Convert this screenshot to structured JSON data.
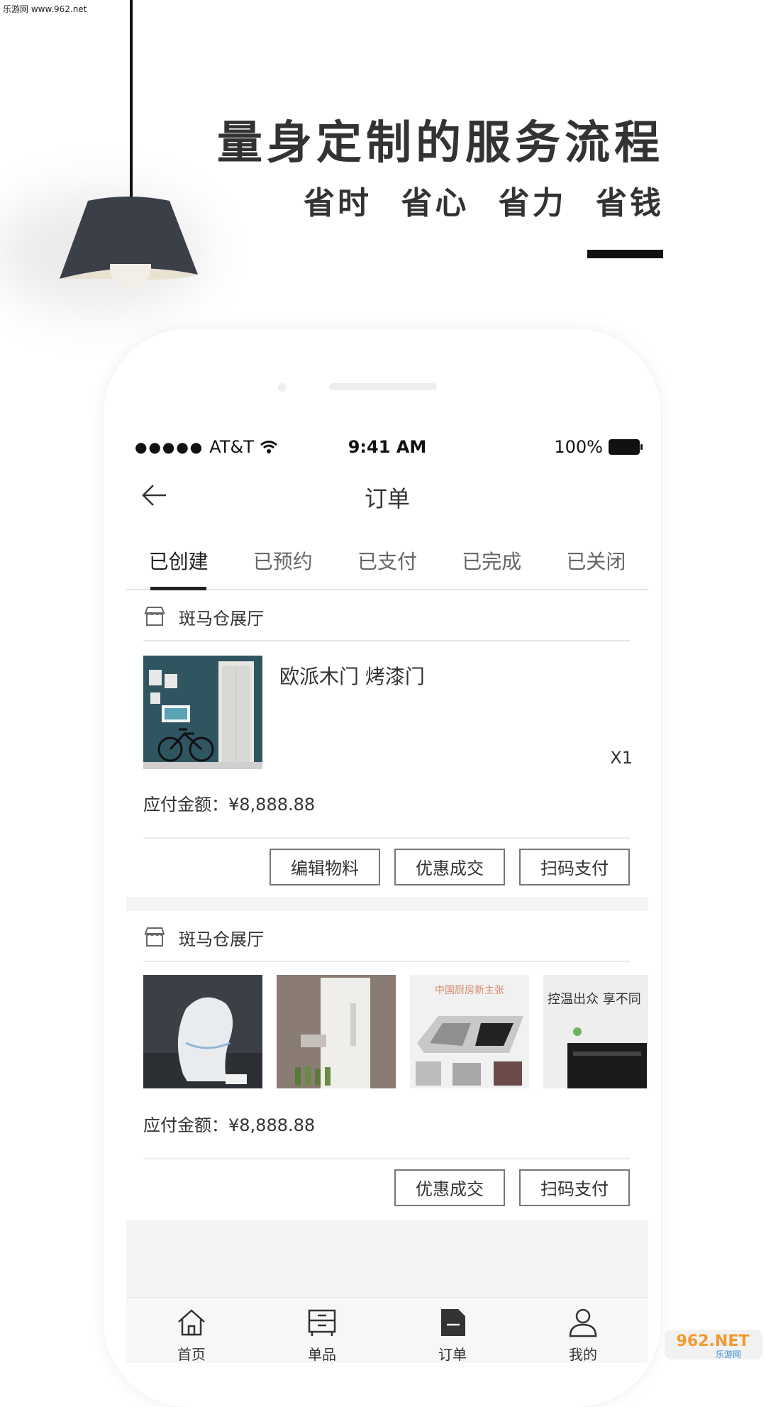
{
  "watermark": "乐游网 www.962.net",
  "hero": {
    "headline": "量身定制的服务流程",
    "taglines": [
      "省时",
      "省心",
      "省力",
      "省钱"
    ]
  },
  "status_bar": {
    "carrier": "AT&T",
    "time": "9:41 AM",
    "battery": "100%"
  },
  "nav": {
    "title": "订单"
  },
  "tabs": [
    {
      "label": "已创建",
      "active": true
    },
    {
      "label": "已预约",
      "active": false
    },
    {
      "label": "已支付",
      "active": false
    },
    {
      "label": "已完成",
      "active": false
    },
    {
      "label": "已关闭",
      "active": false
    }
  ],
  "orders": [
    {
      "shop": "斑马仓展厅",
      "product_title": "欧派木门 烤漆门",
      "quantity": "X1",
      "amount_label": "应付金额：",
      "amount": "¥8,888.88",
      "buttons": [
        "编辑物料",
        "优惠成交",
        "扫码支付"
      ]
    },
    {
      "shop": "斑马仓展厅",
      "thumb_texts": {
        "kitchen": "中国厨房新主张",
        "oven": "控温出众 享不同"
      },
      "amount_label": "应付金额：",
      "amount": "¥8,888.88",
      "buttons": [
        "优惠成交",
        "扫码支付"
      ]
    }
  ],
  "tabbar": [
    {
      "label": "首页",
      "icon": "home-icon"
    },
    {
      "label": "单品",
      "icon": "product-icon"
    },
    {
      "label": "订单",
      "icon": "order-icon",
      "active": true
    },
    {
      "label": "我的",
      "icon": "profile-icon"
    }
  ],
  "corner_logo": {
    "main": "962.NET",
    "sub": "乐游网"
  },
  "colors": {
    "accent": "#222222",
    "tabbar_bg": "#f7f7f7",
    "gap_bg": "#f4f4f4"
  }
}
